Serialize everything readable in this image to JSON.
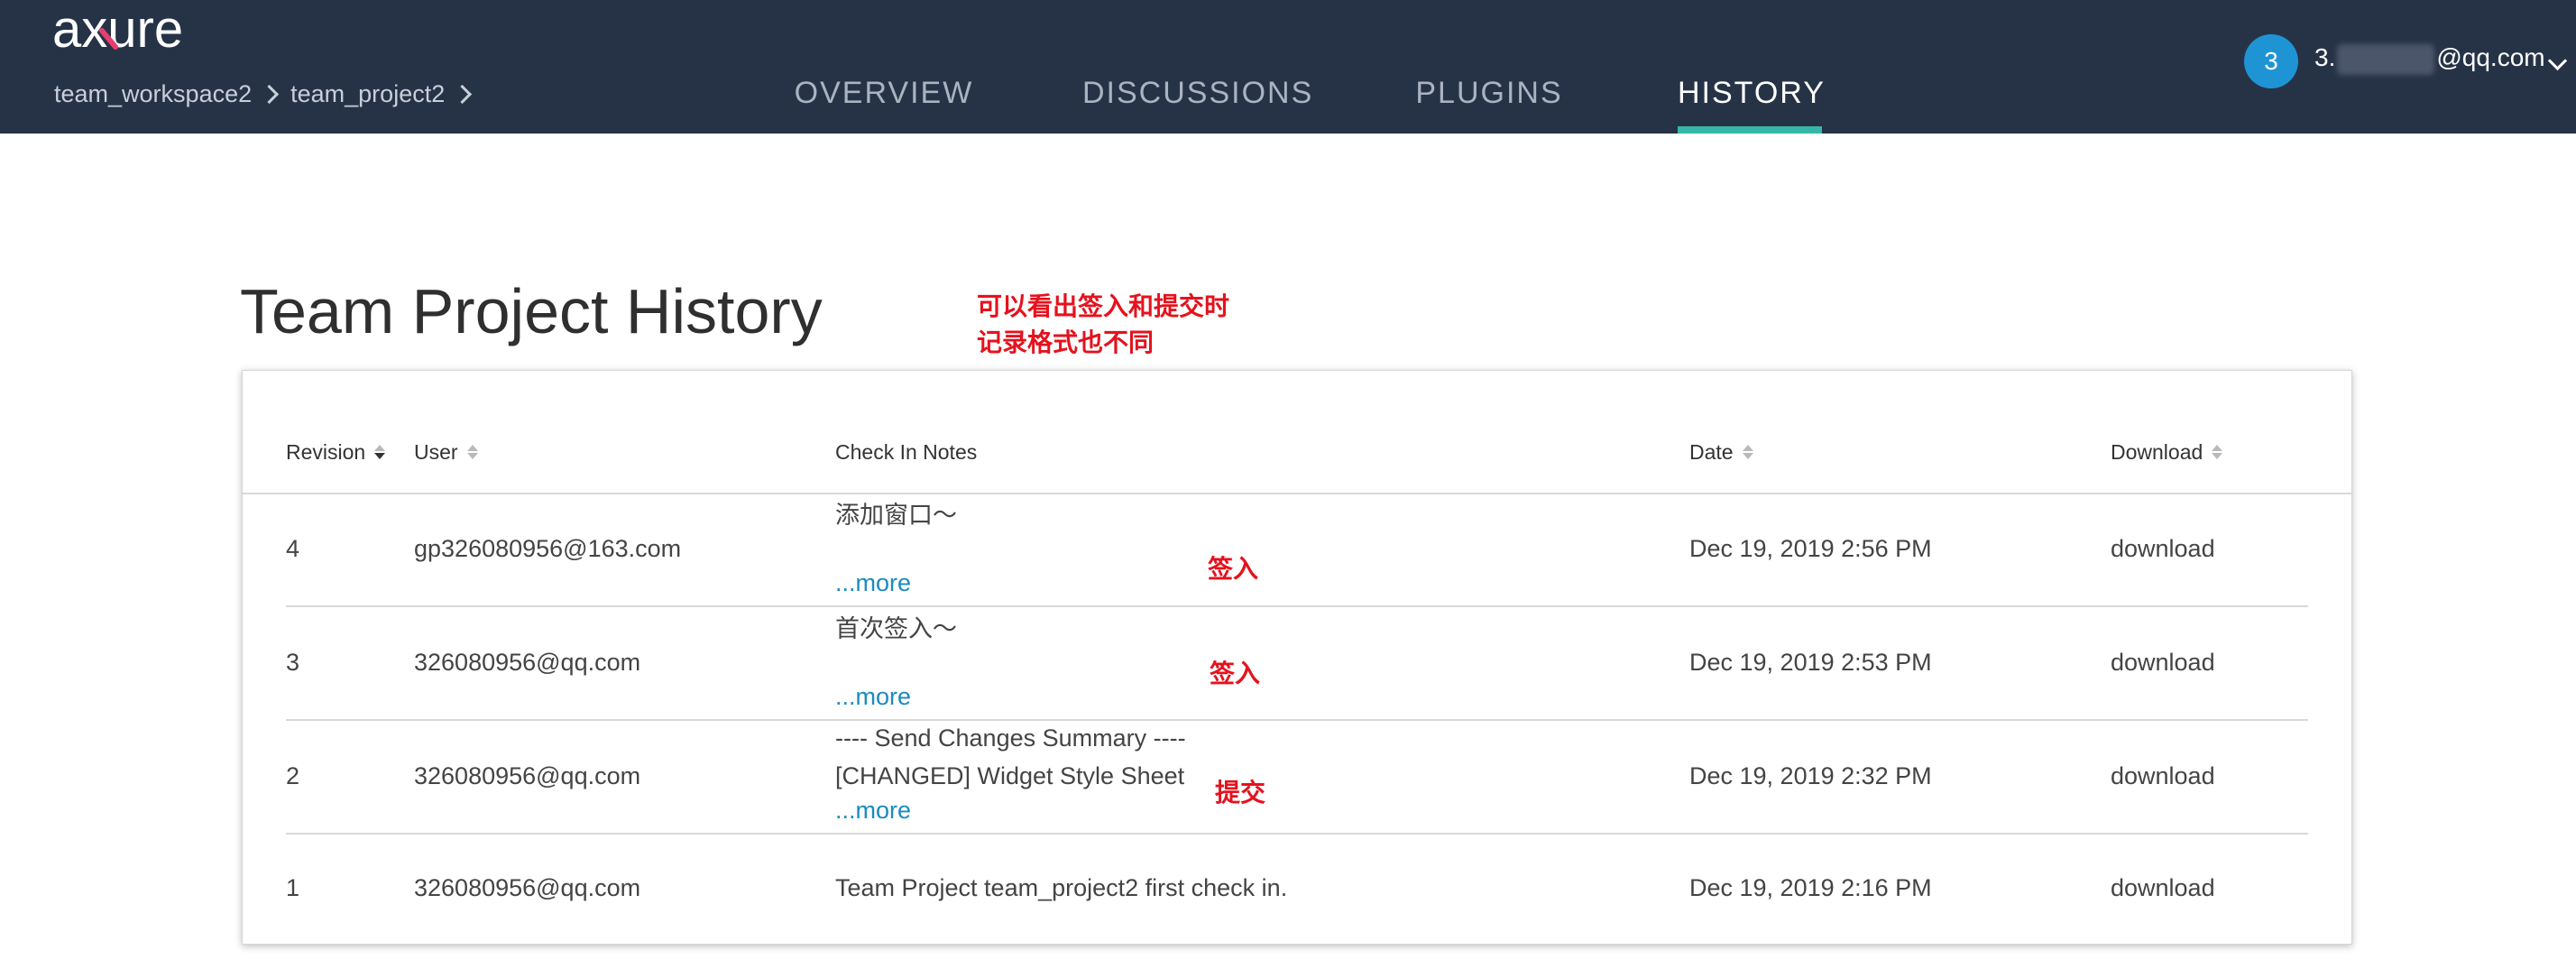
{
  "header": {
    "logo_text": "axure",
    "breadcrumb": [
      "team_workspace2",
      "team_project2"
    ],
    "tabs": [
      {
        "label": "OVERVIEW",
        "active": false
      },
      {
        "label": "DISCUSSIONS",
        "active": false
      },
      {
        "label": "PLUGINS",
        "active": false
      },
      {
        "label": "HISTORY",
        "active": true
      }
    ],
    "user": {
      "avatar_text": "3",
      "email_prefix": "3.",
      "email_suffix": "@qq.com"
    },
    "accent_color": "#36b6a7",
    "bar_color": "#263347"
  },
  "title": "Team Project History",
  "annotations": {
    "main_line1": "可以看出签入和提交时",
    "main_line2": "记录格式也不同",
    "row4": "签入",
    "row3": "签入",
    "row2": "提交"
  },
  "table": {
    "columns": [
      "Revision",
      "User",
      "Check In Notes",
      "Date",
      "Download"
    ],
    "more_label": "...more",
    "rows": [
      {
        "revision": "4",
        "user": "gp326080956@163.com",
        "notes": [
          "添加窗口～"
        ],
        "more": true,
        "date": "Dec 19, 2019 2:56 PM",
        "download": "download"
      },
      {
        "revision": "3",
        "user": "326080956@qq.com",
        "notes": [
          "首次签入～"
        ],
        "more": true,
        "date": "Dec 19, 2019 2:53 PM",
        "download": "download"
      },
      {
        "revision": "2",
        "user": "326080956@qq.com",
        "notes": [
          "---- Send Changes Summary ----",
          "[CHANGED]  Widget Style Sheet"
        ],
        "more": true,
        "date": "Dec 19, 2019 2:32 PM",
        "download": "download"
      },
      {
        "revision": "1",
        "user": "326080956@qq.com",
        "notes": [
          "Team Project team_project2 first check in."
        ],
        "more": false,
        "date": "Dec 19, 2019 2:16 PM",
        "download": "download"
      }
    ]
  }
}
